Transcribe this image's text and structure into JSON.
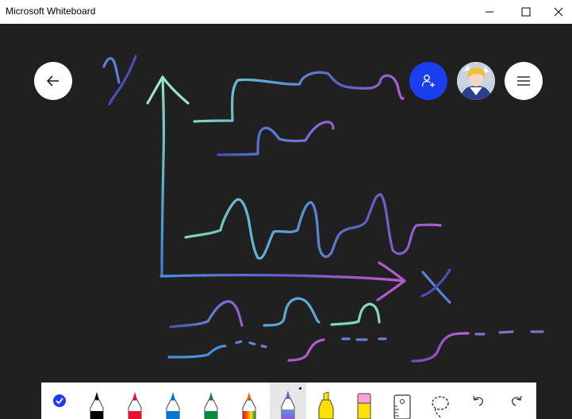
{
  "window": {
    "title": "Microsoft Whiteboard",
    "controls": [
      "minimize",
      "maximize",
      "close"
    ]
  },
  "canvas": {
    "background": "#202020",
    "ink_style": "galaxy",
    "handwriting": {
      "y_axis_letter": "y",
      "x_axis_letter": "x"
    }
  },
  "buttons": {
    "back": {
      "icon": "arrow-left-icon"
    },
    "invite": {
      "icon": "add-person-icon",
      "color": "#1a3ef0"
    },
    "profile": {
      "icon": "avatar"
    },
    "menu": {
      "icon": "hamburger-icon"
    }
  },
  "toolbar": {
    "tools": [
      {
        "name": "select",
        "icon": "checkmark-icon",
        "color": "#1a3ef0"
      },
      {
        "name": "pen-black",
        "icon": "pen-icon",
        "color": "#000000"
      },
      {
        "name": "pen-red",
        "icon": "pen-icon",
        "color": "#e8112d"
      },
      {
        "name": "pen-blue",
        "icon": "pen-icon",
        "color": "#0078d4"
      },
      {
        "name": "pen-green",
        "icon": "pen-icon",
        "color": "#10893e"
      },
      {
        "name": "pen-rainbow",
        "icon": "pen-icon",
        "color": "#f7630c"
      },
      {
        "name": "pen-galaxy",
        "icon": "pen-icon",
        "color": "#8a8fbf",
        "selected": true
      },
      {
        "name": "highlighter-yellow",
        "icon": "highlighter-icon",
        "color": "#fce100"
      },
      {
        "name": "eraser",
        "icon": "eraser-icon",
        "color": "#ff9ed8"
      },
      {
        "name": "ruler",
        "icon": "ruler-icon"
      },
      {
        "name": "lasso",
        "icon": "lasso-icon"
      },
      {
        "name": "undo",
        "icon": "undo-icon"
      },
      {
        "name": "redo",
        "icon": "redo-icon"
      }
    ]
  }
}
